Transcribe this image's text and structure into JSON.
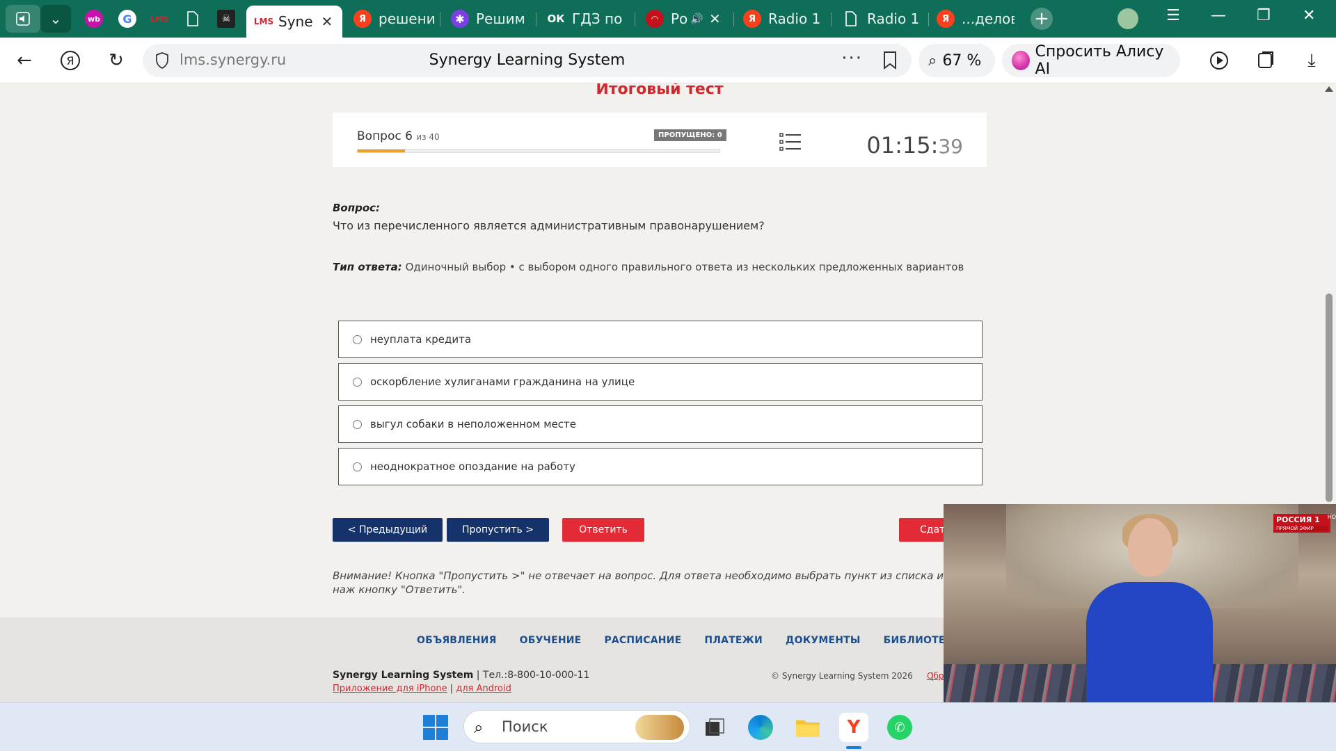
{
  "browser": {
    "tabs": [
      {
        "label": "",
        "icon": "wb",
        "color": "#cb11ab"
      },
      {
        "label": "",
        "icon": "G",
        "color": "#ffffff"
      },
      {
        "label": "",
        "icon": "LMS",
        "color": "#d1282f"
      },
      {
        "label": "",
        "icon": "doc",
        "color": "#ffffff"
      },
      {
        "label": "",
        "icon": "pirate",
        "color": "#222222"
      },
      {
        "label": "Syne",
        "icon": "LMS",
        "color": "#d1282f",
        "active": true
      },
      {
        "label": "решени",
        "icon": "Я",
        "color": "#fc3f1d"
      },
      {
        "label": "Решим",
        "icon": "✱",
        "color": "#7b3fe4"
      },
      {
        "label": "ГДЗ по",
        "icon": "ОК",
        "color": "#0f6e57"
      },
      {
        "label": "Ро",
        "icon": "lips",
        "color": "#c4121c"
      },
      {
        "label": "Radio 1",
        "icon": "Я",
        "color": "#fc3f1d"
      },
      {
        "label": "Radio 1",
        "icon": "doc",
        "color": "#ffffff"
      },
      {
        "label": "...делов",
        "icon": "Я",
        "color": "#fc3f1d"
      }
    ],
    "url_host": "lms.synergy.ru",
    "url_title": "Synergy Learning System",
    "zoom": "67 %",
    "alice": "Спросить Алису AI"
  },
  "page": {
    "title": "Итоговый тест",
    "question_counter": "Вопрос 6",
    "question_total": "из 40",
    "skipped_badge": "ПРОПУЩЕНО: 0",
    "progress_fraction": 0.13,
    "timer_main": "01:15:",
    "timer_seconds": "39",
    "question_heading": "Вопрос:",
    "question_text": "Что из перечисленного является административным правонарушением?",
    "answer_type_label": "Тип ответа:",
    "answer_type_value": " Одиночный выбор • с выбором одного правильного ответа из нескольких предложенных вариантов",
    "options": [
      "неуплата кредита",
      "оскорбление хулиганами гражданина на улице",
      "выгул собаки в неположенном месте",
      "неоднократное опоздание на работу"
    ],
    "buttons": {
      "prev": "< Предыдущий",
      "skip": "Пропустить >",
      "answer": "Ответить",
      "submit": "Сдат"
    },
    "warning": "Внимание! Кнопка \"Пропустить >\" не отвечает на вопрос. Для ответа необходимо выбрать пункт из списка и наж кнопку \"Ответить\"."
  },
  "footer": {
    "nav": [
      "ОБЪЯВЛЕНИЯ",
      "ОБУЧЕНИЕ",
      "РАСПИСАНИЕ",
      "ПЛАТЕЖИ",
      "ДОКУМЕНТЫ",
      "БИБЛИОТЕКА"
    ],
    "brand": "Synergy Learning System",
    "phone": "|  Тел.:8-800-10-000-11",
    "app_iphone": "Приложение для iPhone",
    "app_sep": " | ",
    "app_android": "для Android",
    "copyright": "© Synergy Learning System 2026",
    "copy_sep": "|",
    "obr": "Обр"
  },
  "pip": {
    "channel": "РОССИЯ 1",
    "live": "ПРЯМОЙ ЭФИР",
    "corner": "НО"
  },
  "taskbar": {
    "search_placeholder": "Поиск"
  },
  "colors": {
    "accent_red": "#d1282f",
    "navy": "#15326a",
    "progress": "#f0a028",
    "browser_green": "#0f6e57"
  }
}
